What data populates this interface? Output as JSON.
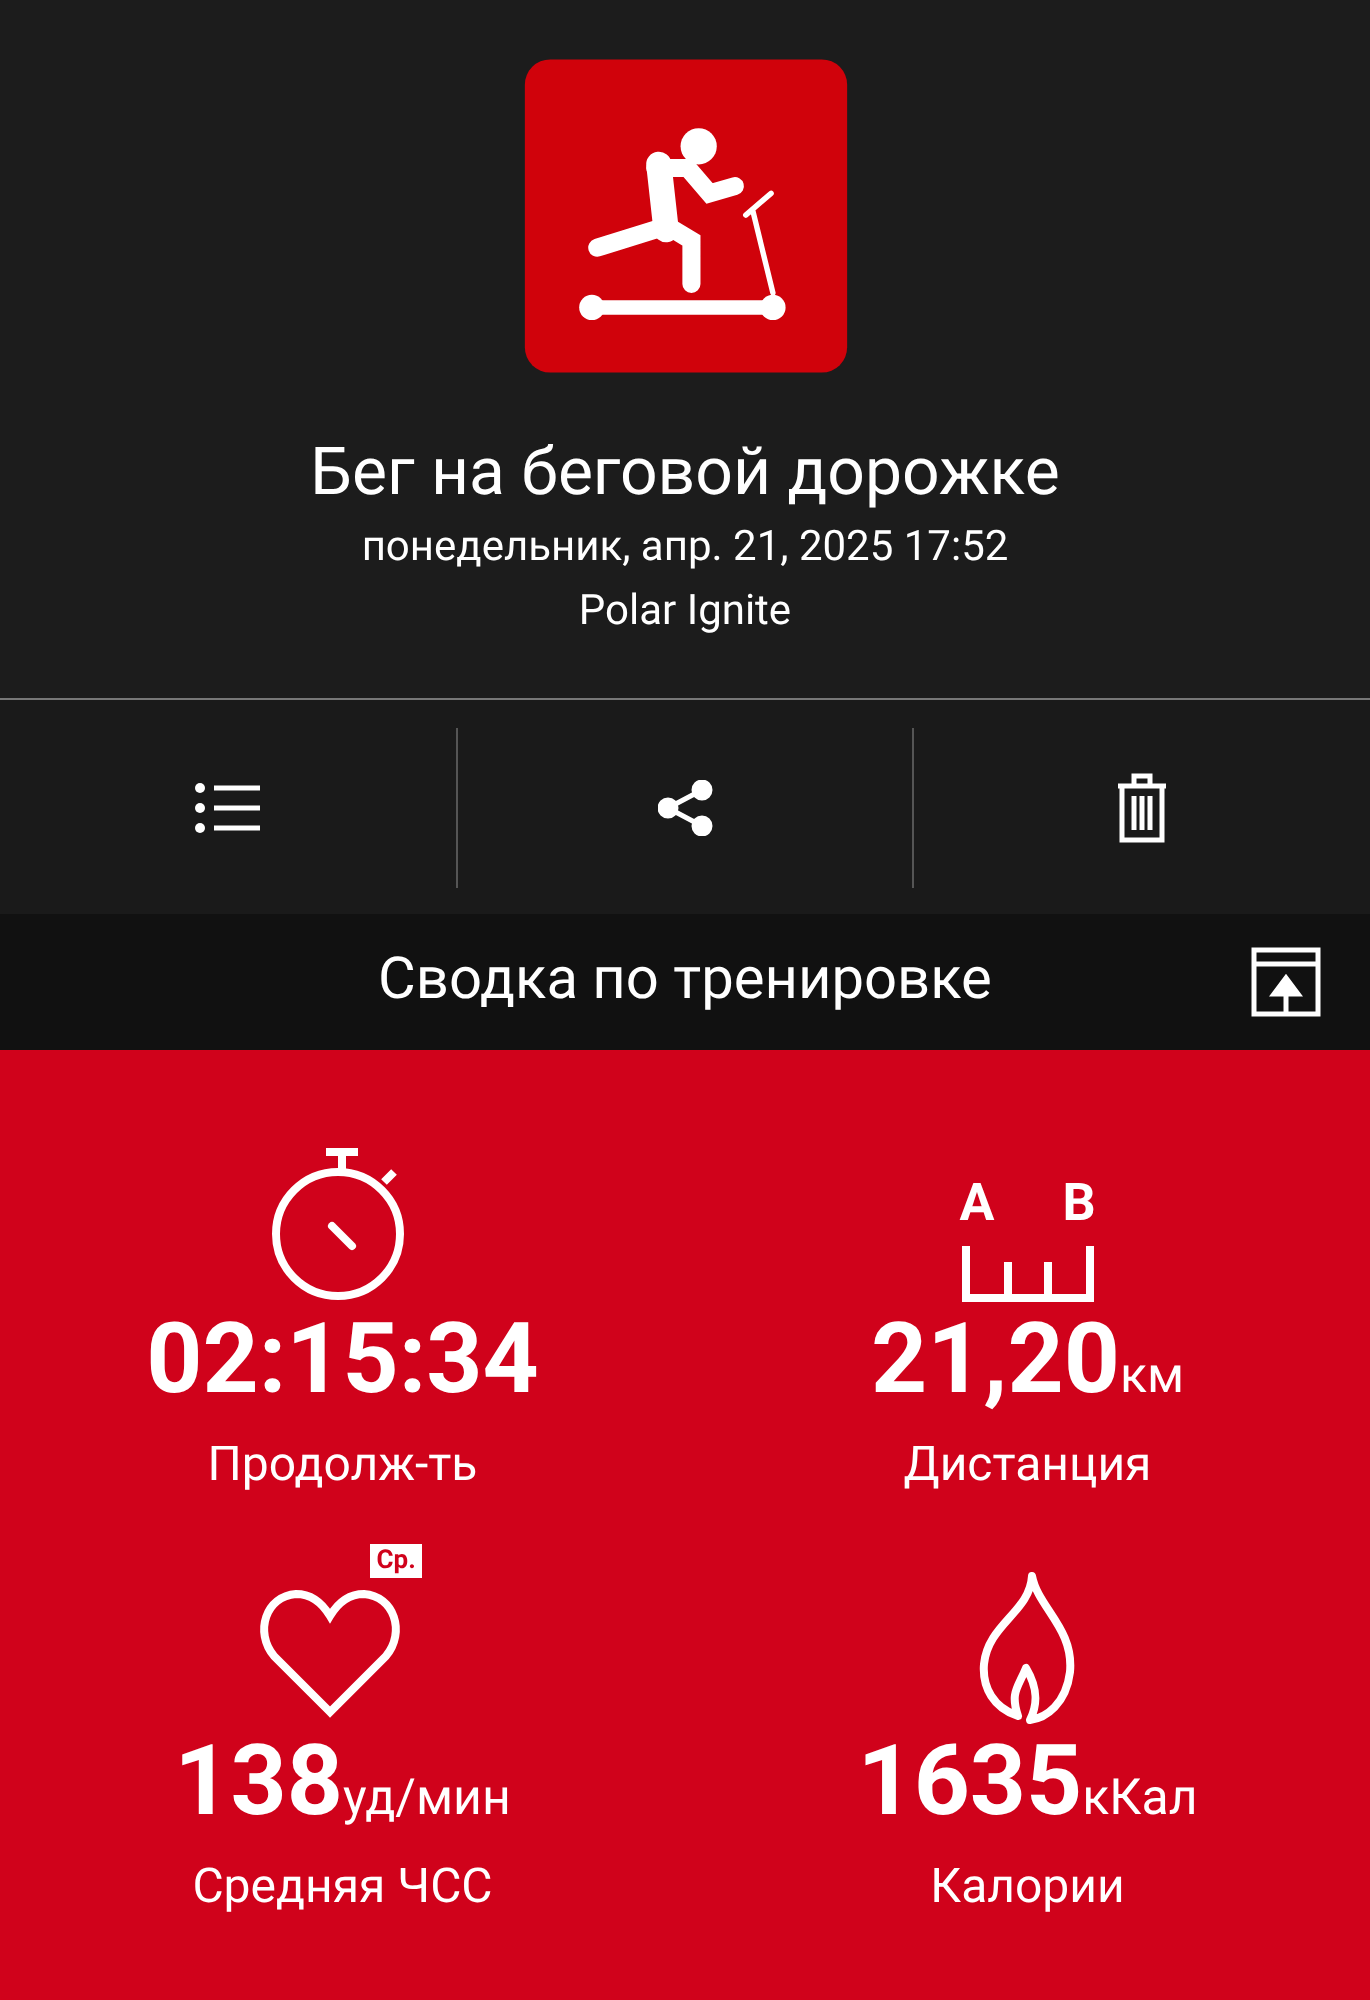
{
  "header": {
    "title": "Бег на беговой дорожке",
    "date": "понедельник, апр. 21, 2025 17:52",
    "device": "Polar Ignite"
  },
  "toolbar": [
    {
      "kind": "list"
    },
    {
      "kind": "share"
    },
    {
      "kind": "delete"
    }
  ],
  "summary": {
    "title": "Сводка по тренировке"
  },
  "stats": [
    {
      "kind": "duration",
      "value": "02:15:34",
      "label": "Продолж-ть"
    },
    {
      "kind": "distance",
      "icon_labels": [
        "A",
        "B"
      ],
      "value": "21,20",
      "unit": "км",
      "label": "Дистанция"
    },
    {
      "kind": "heart",
      "badge": "Ср.",
      "value": "138",
      "unit": "уд/мин",
      "label": "Средняя ЧСС"
    },
    {
      "kind": "calories",
      "value": "1635",
      "unit": "кКал",
      "label": "Калории"
    }
  ]
}
